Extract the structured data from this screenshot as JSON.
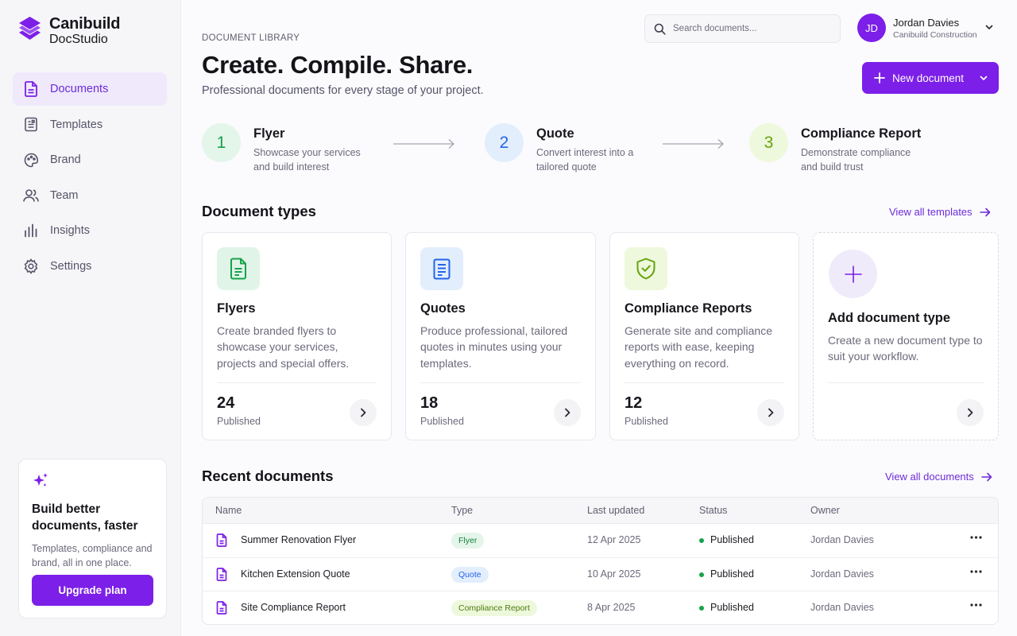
{
  "app": {
    "name": "Canibuild",
    "product": "DocStudio"
  },
  "sidebar": {
    "items": [
      {
        "label": "Documents",
        "icon": "document-icon",
        "active": true
      },
      {
        "label": "Templates",
        "icon": "template-icon",
        "active": false
      },
      {
        "label": "Brand",
        "icon": "palette-icon",
        "active": false
      },
      {
        "label": "Team",
        "icon": "users-icon",
        "active": false
      },
      {
        "label": "Insights",
        "icon": "bar-chart-icon",
        "active": false
      },
      {
        "label": "Settings",
        "icon": "gear-icon",
        "active": false
      }
    ],
    "promo": {
      "icon": "sparkle-icon",
      "title": "Build better documents, faster",
      "text": "Templates, compliance and brand, all in one place.",
      "button": "Upgrade plan"
    }
  },
  "topbar": {
    "search_placeholder": "Search documents...",
    "user": {
      "initials": "JD",
      "name": "Jordan Davies",
      "company": "Canibuild Construction"
    }
  },
  "header": {
    "eyebrow": "DOCUMENT LIBRARY",
    "title": "Create. Compile. Share.",
    "subtitle": "Professional documents for every stage of your project.",
    "new_button": "New document"
  },
  "steps": [
    {
      "number": "1",
      "title": "Flyer",
      "desc": "Showcase your services and build interest"
    },
    {
      "number": "2",
      "title": "Quote",
      "desc": "Convert interest into a tailored quote"
    },
    {
      "number": "3",
      "title": "Compliance Report",
      "desc": "Demonstrate compliance and build trust"
    }
  ],
  "document_types": {
    "title": "Document types",
    "link": "View all templates",
    "cards": [
      {
        "title": "Flyers",
        "desc": "Create branded flyers to showcase your services, projects and special offers.",
        "count": "24",
        "count_label": "Published",
        "icon": "flyer-icon"
      },
      {
        "title": "Quotes",
        "desc": "Produce professional, tailored quotes in minutes using your templates.",
        "count": "18",
        "count_label": "Published",
        "icon": "quote-icon"
      },
      {
        "title": "Compliance Reports",
        "desc": "Generate site and compliance reports with ease, keeping everything on record.",
        "count": "12",
        "count_label": "Published",
        "icon": "shield-check-icon"
      }
    ],
    "add_card": {
      "title": "Add document type",
      "desc": "Create a new document type to suit your workflow.",
      "icon": "plus-icon"
    }
  },
  "recent": {
    "title": "Recent documents",
    "link": "View all documents",
    "columns": [
      "Name",
      "Type",
      "Last updated",
      "Status",
      "Owner"
    ],
    "rows": [
      {
        "name": "Summer Renovation Flyer",
        "type": "Flyer",
        "updated": "12 Apr 2025",
        "status": "Published",
        "owner": "Jordan Davies"
      },
      {
        "name": "Kitchen Extension Quote",
        "type": "Quote",
        "updated": "10 Apr 2025",
        "status": "Published",
        "owner": "Jordan Davies"
      },
      {
        "name": "Site Compliance Report",
        "type": "Compliance Report",
        "updated": "8 Apr 2025",
        "status": "Published",
        "owner": "Jordan Davies"
      }
    ]
  },
  "colors": {
    "accent": "#7c1fe8",
    "flyer": "#16a34a",
    "quote": "#2563eb",
    "compliance": "#65a30d",
    "status_published": "#16a34a"
  }
}
